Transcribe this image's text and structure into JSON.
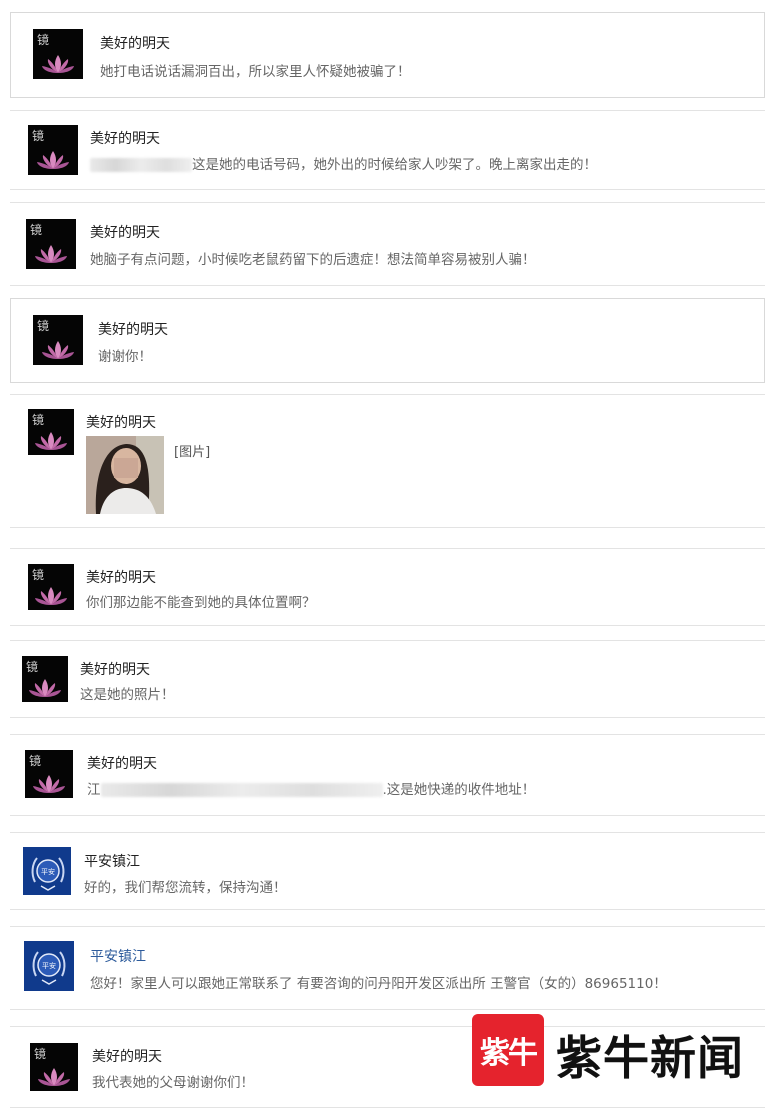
{
  "messages": [
    {
      "sender": "美好的明天",
      "text": "她打电话说话漏洞百出，所以家里人怀疑她被骗了！"
    },
    {
      "sender": "美好的明天",
      "text": "这是她的电话号码，她外出的时候给家人吵架了。晚上离家出走的！"
    },
    {
      "sender": "美好的明天",
      "text": "她脑子有点问题，小时候吃老鼠药留下的后遗症！想法简单容易被别人骗！"
    },
    {
      "sender": "美好的明天",
      "text": "谢谢你！"
    },
    {
      "sender": "美好的明天",
      "text": "[图片]"
    },
    {
      "sender": "美好的明天",
      "text": "你们那边能不能查到她的具体位置啊？"
    },
    {
      "sender": "美好的明天",
      "text": "这是她的照片！"
    },
    {
      "sender": "美好的明天",
      "text": ".这是她快递的收件地址！"
    },
    {
      "sender": "平安镇江",
      "text": "好的，我们帮您流转，保持沟通！"
    },
    {
      "sender": "平安镇江",
      "text": "您好！家里人可以跟她正常联系了 有要咨询的问丹阳开发区派出所 王警官（女的）86965110！"
    },
    {
      "sender": "美好的明天",
      "text": "我代表她的父母谢谢你们！"
    }
  ],
  "partial_address_char": "江",
  "avatar_glyph": "镜",
  "emblem_text": "平安",
  "watermark": {
    "logo_text": "紫牛",
    "brand_text": "紫牛新闻"
  },
  "colors": {
    "accent_red": "#e5232d",
    "police_blue": "#103a8c",
    "name_blue": "#2d5b9b"
  }
}
